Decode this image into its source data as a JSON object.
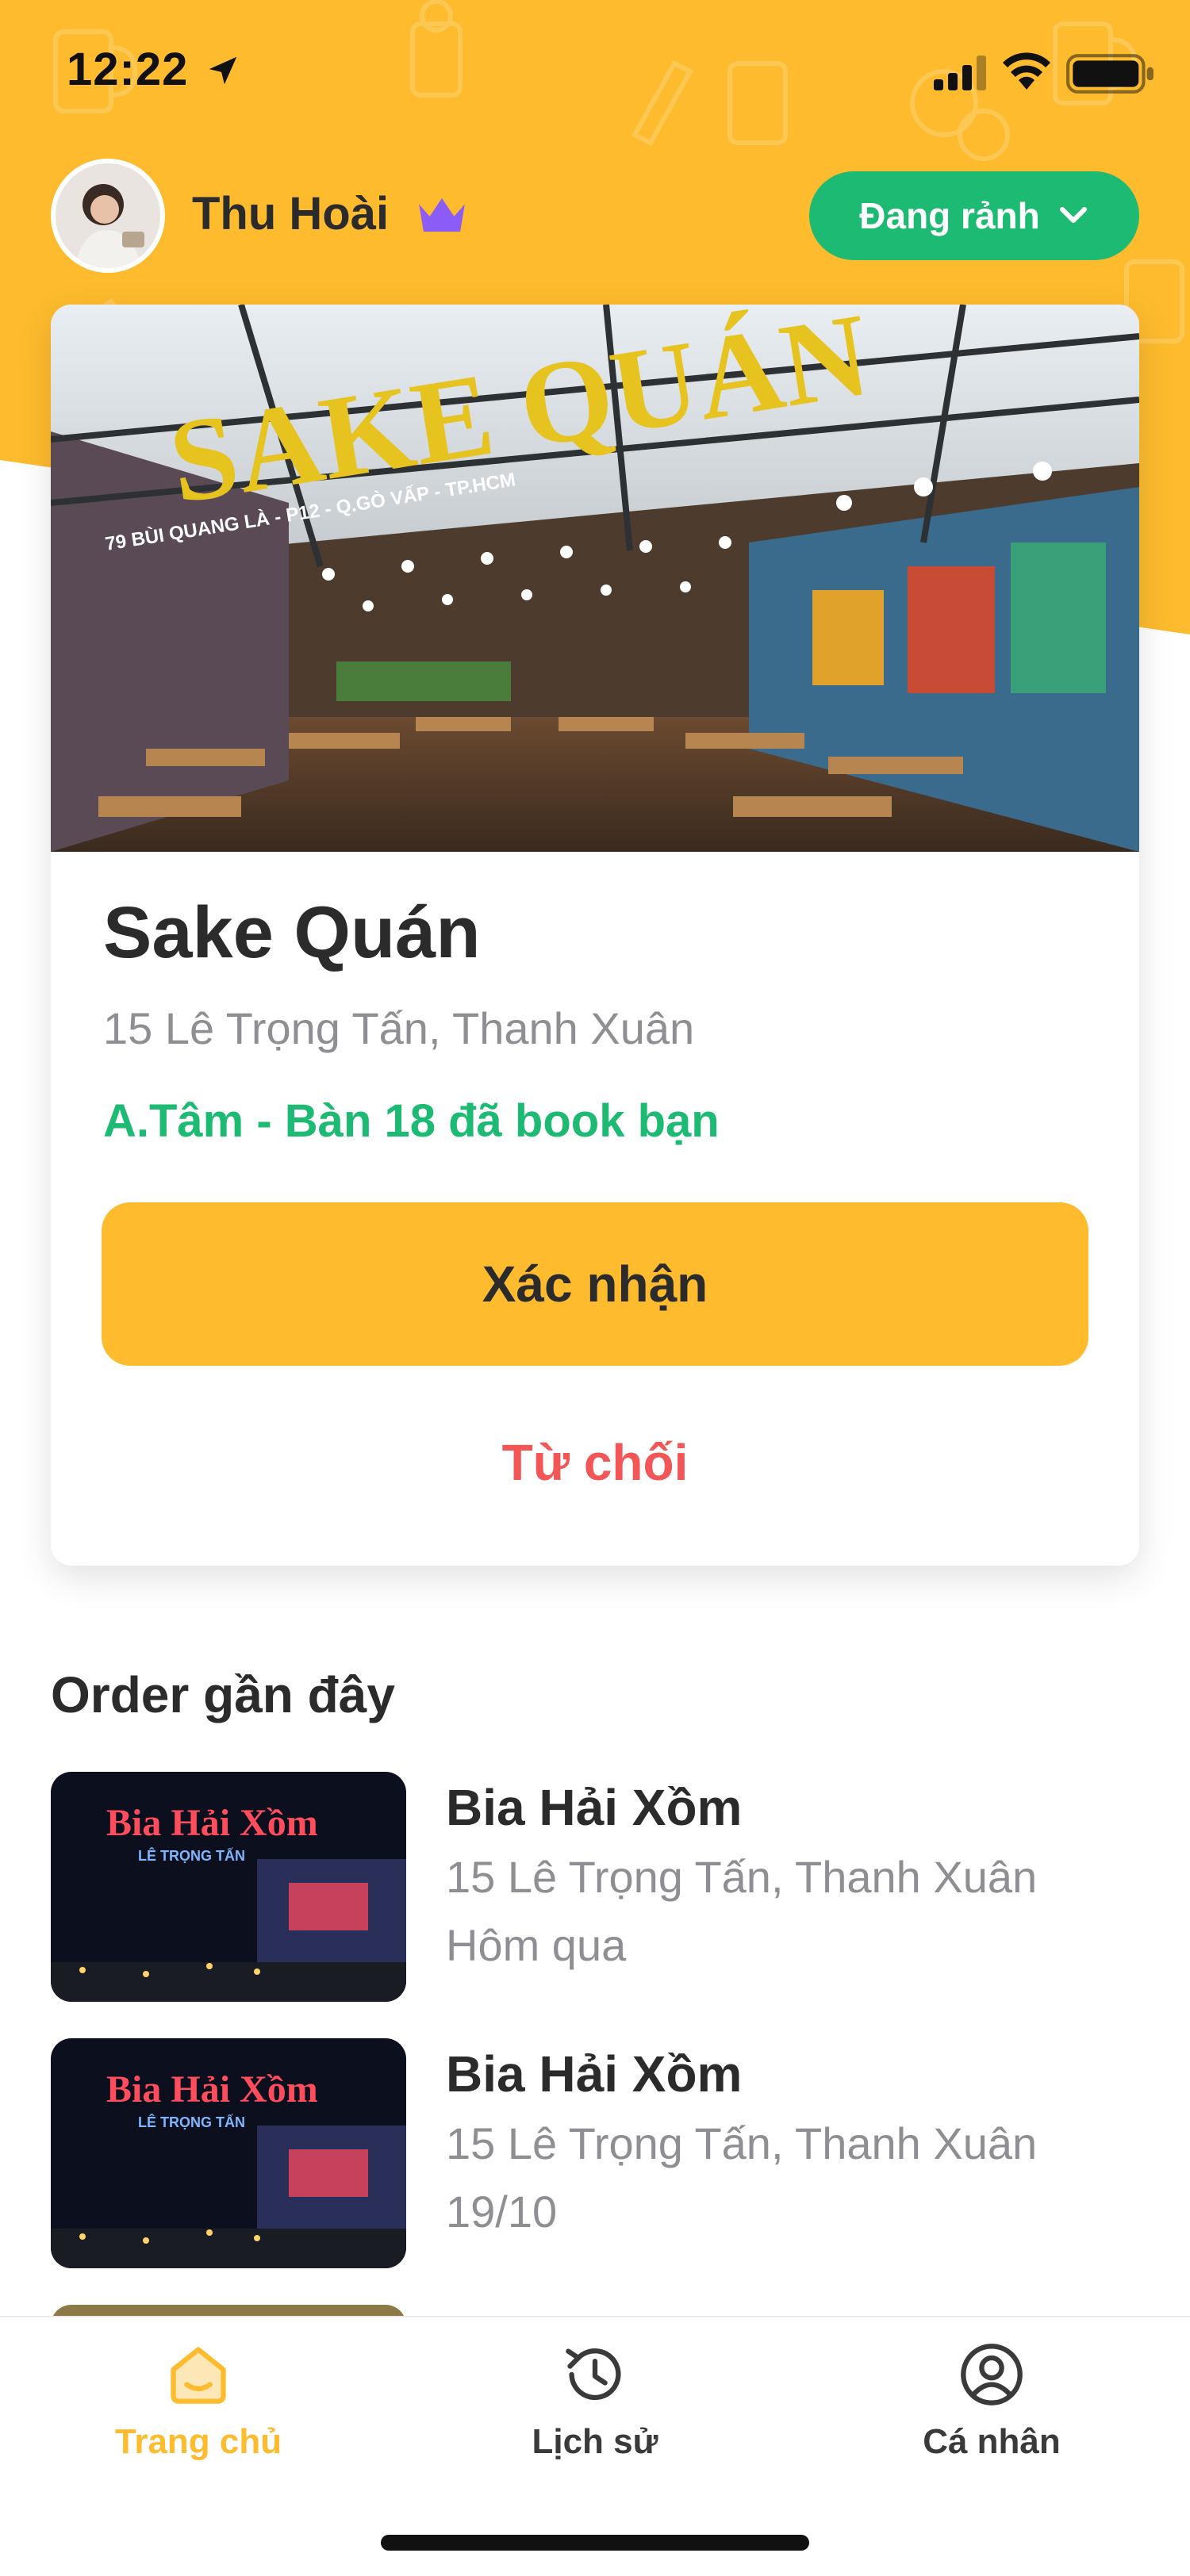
{
  "status_bar": {
    "time": "12:22",
    "icons": [
      "location-arrow-icon",
      "cellular-signal-icon",
      "wifi-icon",
      "battery-icon"
    ]
  },
  "profile": {
    "name": "Thu Hoài",
    "badge_icon": "crown-icon",
    "status_label": "Đang rảnh",
    "status_icon": "chevron-down-icon"
  },
  "card": {
    "image_sign_text": "SAKE QUÁN",
    "image_sign_subtext": "79 BÙI QUANG LÀ - P12 - Q.GÒ VẤP - TP.HCM",
    "venue_name": "Sake Quán",
    "address": "15 Lê Trọng Tấn, Thanh Xuân",
    "booking_note": "A.Tâm - Bàn 18 đã book bạn",
    "confirm_label": "Xác nhận",
    "reject_label": "Từ chối"
  },
  "recent_orders": {
    "title": "Order gần đây",
    "items": [
      {
        "name": "Bia Hải Xồm",
        "address": "15 Lê Trọng Tấn, Thanh Xuân",
        "date": "Hôm qua",
        "thumb_sign": "Bia Hải Xồm",
        "thumb_subsign": "LÊ TRỌNG TẤN"
      },
      {
        "name": "Bia Hải Xồm",
        "address": "15 Lê Trọng Tấn, Thanh Xuân",
        "date": "19/10",
        "thumb_sign": "Bia Hải Xồm",
        "thumb_subsign": "LÊ TRỌNG TẤN"
      }
    ]
  },
  "tab_bar": {
    "tabs": [
      {
        "label": "Trang chủ",
        "icon": "home-icon",
        "active": true
      },
      {
        "label": "Lịch sử",
        "icon": "history-icon",
        "active": false
      },
      {
        "label": "Cá nhân",
        "icon": "user-icon",
        "active": false
      }
    ]
  },
  "colors": {
    "brand_yellow": "#fdbb2d",
    "status_green": "#1cba72",
    "reject_red": "#f25656",
    "crown_purple": "#8b5cf6",
    "text_dark": "#2b2b2b",
    "text_gray": "#8e8e93"
  }
}
